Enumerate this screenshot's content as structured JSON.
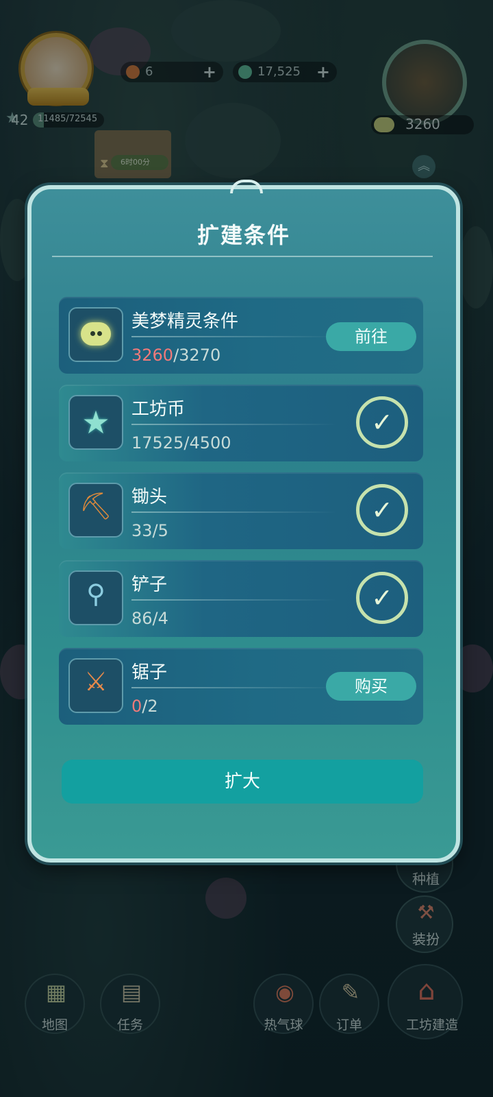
{
  "hud": {
    "level": "42",
    "exp_text": "11485/72545",
    "exp_progress": 0.158,
    "gems": "6",
    "coins": "17,525",
    "building_points": "3260",
    "timer": "6时00分"
  },
  "side_buttons": [
    {
      "label": "种植",
      "icon": "sprout-icon"
    },
    {
      "label": "装扮",
      "icon": "hammer-icon"
    }
  ],
  "bottom_nav": [
    {
      "label": "地图",
      "icon": "map-icon"
    },
    {
      "label": "任务",
      "icon": "clipboard-icon"
    },
    {
      "label": "热气球",
      "icon": "balloon-icon"
    },
    {
      "label": "订单",
      "icon": "scroll-icon"
    },
    {
      "label": "工坊建造",
      "icon": "workshop-icon"
    }
  ],
  "dialog": {
    "title": "扩建条件",
    "rows": [
      {
        "name": "美梦精灵条件",
        "have": "3260",
        "need": "/3270",
        "insufficient": true,
        "action": "前往",
        "icon": "dream-spirit-icon"
      },
      {
        "name": "工坊币",
        "have": "17525",
        "need": "/4500",
        "insufficient": false,
        "icon": "star-coin-icon"
      },
      {
        "name": "锄头",
        "have": "33",
        "need": "/5",
        "insufficient": false,
        "icon": "hoe-icon"
      },
      {
        "name": "铲子",
        "have": "86",
        "need": "/4",
        "insufficient": false,
        "icon": "shovel-icon"
      },
      {
        "name": "锯子",
        "have": "0",
        "need": "/2",
        "insufficient": true,
        "action": "购买",
        "icon": "saw-icon"
      }
    ],
    "confirm_label": "扩大"
  },
  "colors": {
    "dialog_bg": "#2c7f8c",
    "row_bg": "#1f6a85",
    "action_button": "#3aa9a6",
    "confirm_button": "#13a0a0",
    "insufficient_text": "#f07a7a",
    "check_ring": "#c6e2ad"
  }
}
